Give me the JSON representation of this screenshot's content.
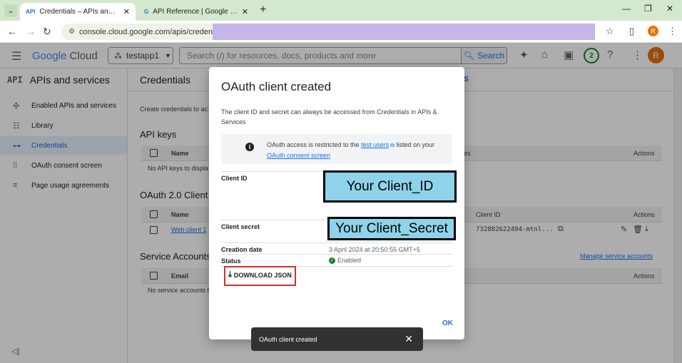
{
  "browser": {
    "tabs": [
      {
        "favicon": "API",
        "title": "Credentials – APIs and services",
        "close": "✕"
      },
      {
        "favicon": "G",
        "title": "API Reference | Google Calendar",
        "close": "✕"
      }
    ],
    "new_tab": "+",
    "url": "console.cloud.google.com/apis/credentials",
    "profile_initial": "R"
  },
  "header": {
    "brand_google": "Google",
    "brand_cloud": "Cloud",
    "project": "testapp1",
    "search_placeholder": "Search (/) for resources, docs, products and more",
    "search_button": "Search",
    "notifications_count": "2",
    "avatar_initial": "R"
  },
  "sidebar": {
    "logo": "API",
    "title": "APIs and services",
    "items": [
      {
        "icon": "✣",
        "label": "Enabled APIs and services"
      },
      {
        "icon": "☷",
        "label": "Library"
      },
      {
        "icon": "⊶",
        "label": "Credentials"
      },
      {
        "icon": "⁞⁞",
        "label": "OAuth consent screen"
      },
      {
        "icon": "≡",
        "label": "Page usage agreements"
      }
    ],
    "collapse": "◁|"
  },
  "main": {
    "title": "Credentials",
    "tab_fragment": "S",
    "intro": "Create credentials to ac",
    "api_keys": {
      "title": "API keys",
      "col_name": "Name",
      "col_restrictions": "es",
      "col_actions": "Actions",
      "empty": "No API keys to displa"
    },
    "oauth": {
      "title": "OAuth 2.0 Client I",
      "col_name": "Name",
      "col_client_id": "Client ID",
      "col_actions": "Actions",
      "row_name": "Web client 1",
      "row_client_id": "732882622494-mtnl..."
    },
    "service_accounts": {
      "title": "Service Accounts",
      "manage_link": "Manage service accounts",
      "col_email": "Email",
      "col_actions": "Actions",
      "empty": "No service accounts t"
    }
  },
  "dialog": {
    "title": "OAuth client created",
    "description": "The client ID and secret can always be accessed from Credentials in APIs & Services",
    "info_prefix": "OAuth access is restricted to the ",
    "info_link1": "test users",
    "info_middle": " listed on your ",
    "info_link2": "OAuth consent screen",
    "client_id_label": "Client ID",
    "client_id_value": "Your Client_ID",
    "client_secret_label": "Client secret",
    "client_secret_value": "Your Client_Secret",
    "creation_date_label": "Creation date",
    "creation_date_value": "3 April 2024 at 20:50:55 GMT+5",
    "status_label": "Status",
    "status_value": "Enabled",
    "download_button": "DOWNLOAD JSON",
    "ok_button": "OK"
  },
  "snackbar": {
    "message": "OAuth client created",
    "close": "✕"
  }
}
